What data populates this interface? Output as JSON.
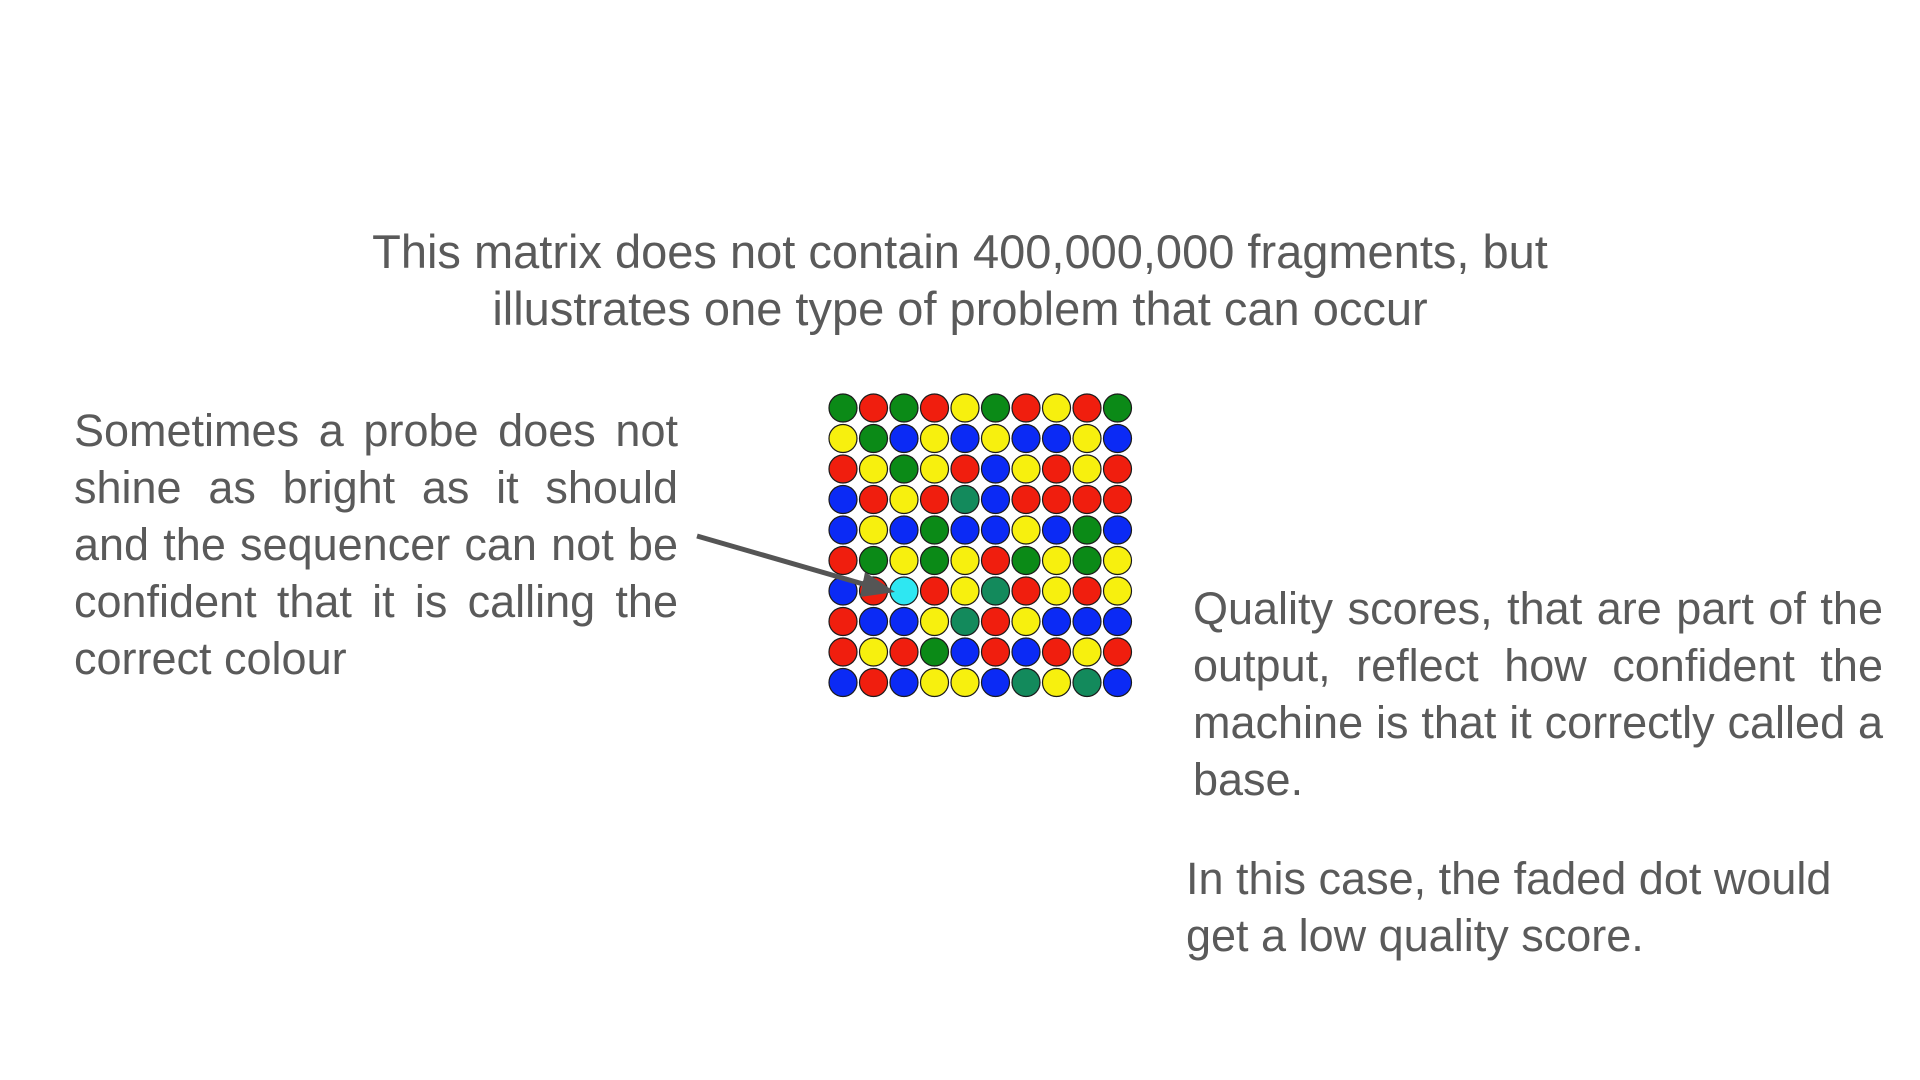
{
  "title": {
    "line1": "This matrix does not contain 400,000,000 fragments, but",
    "line2": "illustrates one type of problem that can occur"
  },
  "left_text": "Sometimes a probe does not shine as bright as it should and the sequencer can not be confident that it is calling the correct colour",
  "right_text": "Quality scores, that are part of the output, reflect how confident the machine is that it correctly called a base.",
  "right_text2": "In this case, the faded dot would get a low quality score.",
  "colors": {
    "G": "#0b8a17",
    "R": "#f01e0e",
    "Y": "#f7f00e",
    "B": "#0b2af5",
    "T": "#138a5c",
    "C": "#2ee7f2"
  },
  "matrix": [
    [
      "G",
      "R",
      "G",
      "R",
      "Y",
      "G",
      "R",
      "Y",
      "R",
      "G"
    ],
    [
      "Y",
      "G",
      "B",
      "Y",
      "B",
      "Y",
      "B",
      "B",
      "Y",
      "B"
    ],
    [
      "R",
      "Y",
      "G",
      "Y",
      "R",
      "B",
      "Y",
      "R",
      "Y",
      "R"
    ],
    [
      "B",
      "R",
      "Y",
      "R",
      "T",
      "B",
      "R",
      "R",
      "R",
      "R"
    ],
    [
      "B",
      "Y",
      "B",
      "G",
      "B",
      "B",
      "Y",
      "B",
      "G",
      "B"
    ],
    [
      "R",
      "G",
      "Y",
      "G",
      "Y",
      "R",
      "G",
      "Y",
      "G",
      "Y"
    ],
    [
      "B",
      "R",
      "C",
      "R",
      "Y",
      "T",
      "R",
      "Y",
      "R",
      "Y"
    ],
    [
      "R",
      "B",
      "B",
      "Y",
      "T",
      "R",
      "Y",
      "B",
      "B",
      "B"
    ],
    [
      "R",
      "Y",
      "R",
      "G",
      "B",
      "R",
      "B",
      "R",
      "Y",
      "R"
    ],
    [
      "B",
      "R",
      "B",
      "Y",
      "Y",
      "B",
      "T",
      "Y",
      "T",
      "B"
    ]
  ],
  "faded_dot": {
    "row": 6,
    "col": 2
  }
}
